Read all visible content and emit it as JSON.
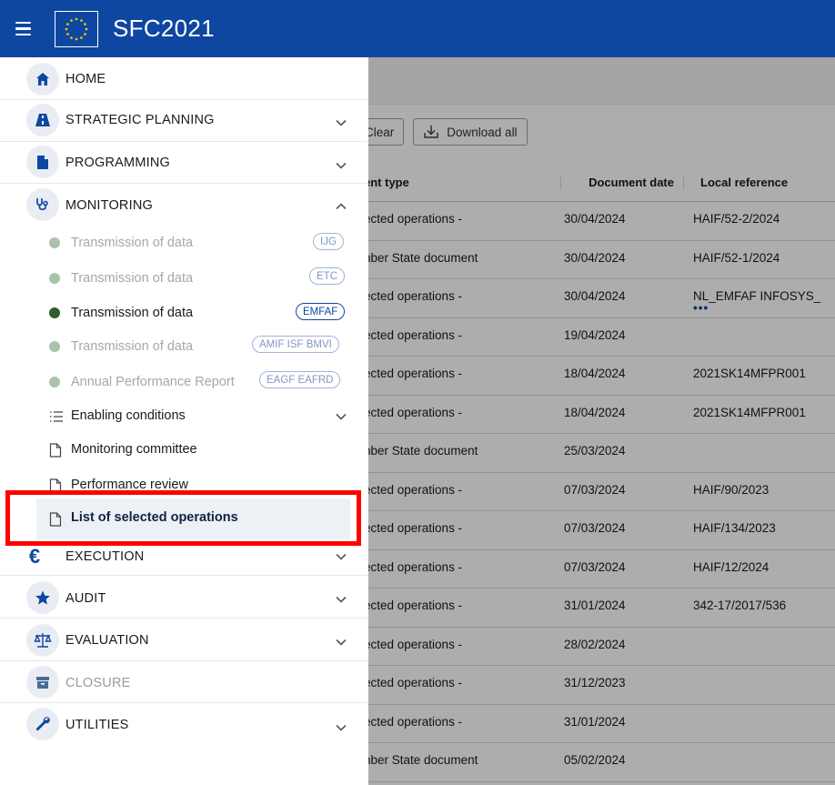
{
  "app": {
    "title": "SFC2021"
  },
  "toolbar": {
    "clear_label": "Clear",
    "download_label": "Download all"
  },
  "table": {
    "headers": [
      "ent type",
      "Document date",
      "Local reference"
    ],
    "rows": [
      {
        "type": "ected operations -",
        "date": "30/04/2024",
        "ref": "HAIF/52-2/2024"
      },
      {
        "type": "nber State document",
        "date": "30/04/2024",
        "ref": "HAIF/52-1/2024"
      },
      {
        "type": "ected operations -",
        "date": "30/04/2024",
        "ref": "NL_EMFAF INFOSYS_"
      },
      {
        "type": "ected operations -",
        "date": "19/04/2024",
        "ref": ""
      },
      {
        "type": "ected operations -",
        "date": "18/04/2024",
        "ref": "2021SK14MFPR001"
      },
      {
        "type": "ected operations -",
        "date": "18/04/2024",
        "ref": "2021SK14MFPR001"
      },
      {
        "type": "nber State document",
        "date": "25/03/2024",
        "ref": ""
      },
      {
        "type": "ected operations -",
        "date": "07/03/2024",
        "ref": "HAIF/90/2023"
      },
      {
        "type": "ected operations -",
        "date": "07/03/2024",
        "ref": "HAIF/134/2023"
      },
      {
        "type": "ected operations -",
        "date": "07/03/2024",
        "ref": "HAIF/12/2024"
      },
      {
        "type": "ected operations -",
        "date": "31/01/2024",
        "ref": "342-17/2017/536"
      },
      {
        "type": "ected operations -",
        "date": "28/02/2024",
        "ref": ""
      },
      {
        "type": "ected operations -",
        "date": "31/12/2023",
        "ref": ""
      },
      {
        "type": "ected operations -",
        "date": "31/01/2024",
        "ref": ""
      },
      {
        "type": "nber State document",
        "date": "05/02/2024",
        "ref": ""
      }
    ]
  },
  "sidebar": {
    "home": "HOME",
    "strategic": "STRATEGIC PLANNING",
    "programming": "PROGRAMMING",
    "monitoring": "MONITORING",
    "monitoring_items": [
      {
        "label": "Transmission of data",
        "tag": "IJG"
      },
      {
        "label": "Transmission of data",
        "tag": "ETC"
      },
      {
        "label": "Transmission of data",
        "tag": "EMFAF"
      },
      {
        "label": "Transmission of data",
        "tag": "AMIF ISF BMVI"
      },
      {
        "label": "Annual Performance Report",
        "tag": "EAGF EAFRD"
      }
    ],
    "enabling": "Enabling conditions",
    "committee": "Monitoring committee",
    "performance": "Performance review",
    "selected_ops": "List of selected operations",
    "execution": "EXECUTION",
    "audit": "AUDIT",
    "evaluation": "EVALUATION",
    "closure": "CLOSURE",
    "utilities": "UTILITIES"
  },
  "colors": {
    "brand": "#0e47a1",
    "highlight": "#ff0000",
    "active_dot": "#2e5e2e",
    "dim_dot": "#a9c3a9"
  }
}
